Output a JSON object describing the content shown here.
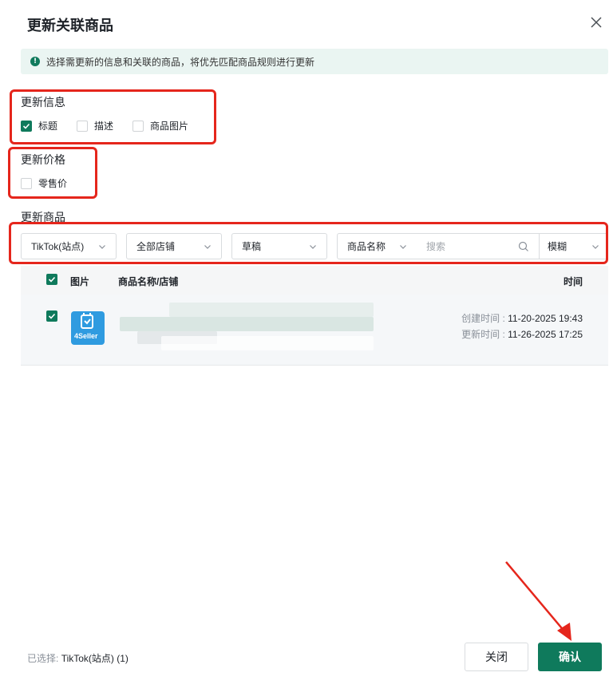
{
  "dialog": {
    "title": "更新关联商品",
    "notice": "选择需更新的信息和关联的商品，将优先匹配商品规则进行更新"
  },
  "update_info": {
    "label": "更新信息",
    "options": [
      {
        "label": "标题",
        "checked": true
      },
      {
        "label": "描述",
        "checked": false
      },
      {
        "label": "商品图片",
        "checked": false
      }
    ]
  },
  "update_price": {
    "label": "更新价格",
    "options": [
      {
        "label": "零售价",
        "checked": false
      }
    ]
  },
  "update_products": {
    "label": "更新商品",
    "filters": {
      "platform": "TikTok(站点)",
      "store": "全部店铺",
      "status": "草稿",
      "search_field": "商品名称",
      "search_placeholder": "搜索",
      "match_mode": "模糊"
    },
    "table": {
      "headers": {
        "image": "图片",
        "name": "商品名称/店铺",
        "time": "时间"
      },
      "rows": [
        {
          "checked": true,
          "logo_text": "4Seller",
          "created_label": "创建时间 :",
          "created_value": "11-20-2025 19:43",
          "updated_label": "更新时间 :",
          "updated_value": "11-26-2025 17:25"
        }
      ]
    }
  },
  "footer": {
    "selected_label": "已选择:",
    "selected_value": "TikTok(站点) (1)",
    "close_label": "关闭",
    "confirm_label": "确认"
  },
  "colors": {
    "brand": "#0f7a5c",
    "annotation": "#e5261c",
    "notice_bg": "#eaf5f2"
  }
}
